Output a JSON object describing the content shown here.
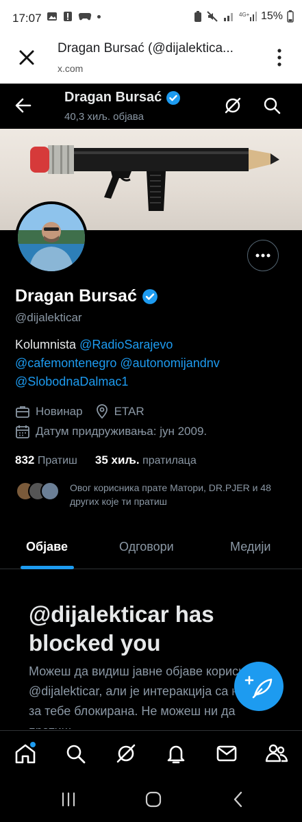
{
  "status_bar": {
    "time": "17:07",
    "battery": "15%"
  },
  "browser": {
    "page_title": "Dragan Bursać (@dijalektica...",
    "url": "x.com"
  },
  "header": {
    "name": "Dragan Bursać",
    "posts_count": "40,3 хиљ. објава"
  },
  "profile": {
    "name": "Dragan Bursać",
    "handle": "@dijalekticar",
    "bio_text": "Kolumnista",
    "bio_mentions": [
      "@RadioSarajevo",
      "@cafemontenegro",
      "@autonomijandnv",
      "@SlobodnaDalmac1"
    ],
    "profession": "Новинар",
    "location": "ETAR",
    "joined": "Датум придруживања: јун 2009.",
    "following_count": "832",
    "following_label": "Пратиш",
    "followers_count": "35 хиљ.",
    "followers_label": "пратилаца",
    "followed_by_text": "Овог корисника прате Матори, DR.PJER и 48 других које ти пратиш"
  },
  "tabs": [
    {
      "label": "Објаве",
      "active": true
    },
    {
      "label": "Одговори",
      "active": false
    },
    {
      "label": "Медији",
      "active": false
    }
  ],
  "blocked": {
    "title": "@dijalekticar has blocked you",
    "body": "Можеш да видиш јавне објаве корисника @dijalekticar, али је интеракција са њима за тебе блокирана. Не можеш ни да пратиш"
  },
  "bottom_nav": [
    "home-icon",
    "search-icon",
    "grok-icon",
    "notifications-icon",
    "messages-icon",
    "communities-icon"
  ],
  "colors": {
    "accent": "#1d9bf0",
    "background": "#000000",
    "secondary_text": "#8b98a5"
  }
}
